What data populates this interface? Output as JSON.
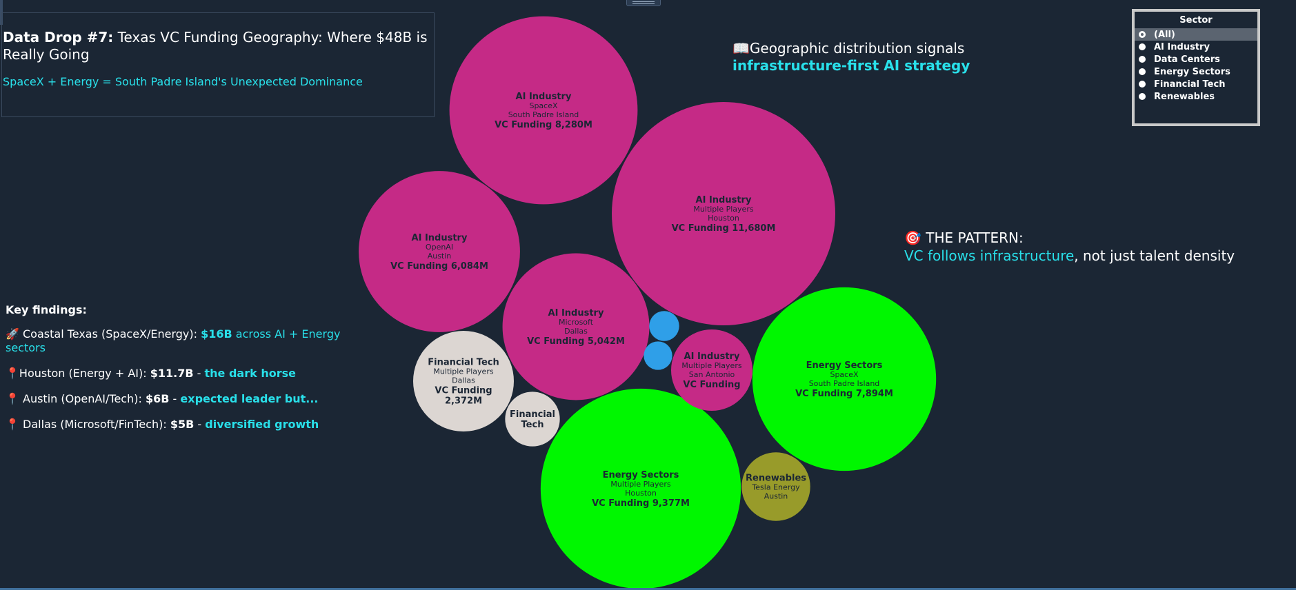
{
  "header": {
    "title_bold": "Data Drop #7:",
    "title_rest": " Texas VC Funding Geography: Where $48B is Really Going",
    "subtitle": "SpaceX + Energy = South Padre Island's Unexpected Dominance"
  },
  "annotations": {
    "top_line1": "Geographic distribution signals",
    "top_line2": "infrastructure-first AI strategy",
    "pattern_head": "THE PATTERN:",
    "pattern_cyan": "VC follows infrastructure",
    "pattern_rest": ", not just talent density"
  },
  "findings": {
    "heading": "Key findings:",
    "items": [
      {
        "prefix": " Coastal Texas (SpaceX/Energy): ",
        "value": "$16B",
        "suffix": " across AI + Energy sectors"
      },
      {
        "prefix": "Houston (Energy + AI): ",
        "value": "$11.7B",
        "sep": " - ",
        "suffix": "the dark horse"
      },
      {
        "prefix": " Austin (OpenAI/Tech): ",
        "value": "$6B",
        "sep": " - ",
        "suffix": "expected leader but..."
      },
      {
        "prefix": " Dallas (Microsoft/FinTech): ",
        "value": "$5B",
        "sep": " - ",
        "suffix": "diversified growth"
      }
    ]
  },
  "legend": {
    "title": "Sector",
    "options": [
      "(All)",
      "AI Industry",
      "Data Centers",
      "Energy Sectors",
      "Financial Tech",
      "Renewables"
    ],
    "selected": "(All)"
  },
  "colors": {
    "AI Industry": "#c52a86",
    "Data Centers": "#2f9fe8",
    "Energy Sectors": "#00f700",
    "Financial Tech": "#dcd6d2",
    "Renewables": "#989b2a"
  },
  "icons": [
    "book-icon",
    "target-icon",
    "rocket-icon",
    "pin-icon"
  ],
  "chart_data": {
    "type": "bubble",
    "value_label": "VC Funding",
    "unit": "M",
    "bubbles": [
      {
        "sector": "AI Industry",
        "company": "Multiple Players",
        "city": "Houston",
        "value": 11680,
        "label": "VC Funding 11,680M"
      },
      {
        "sector": "Energy Sectors",
        "company": "Multiple Players",
        "city": "Houston",
        "value": 9377,
        "label": "VC Funding 9,377M"
      },
      {
        "sector": "AI Industry",
        "company": "SpaceX",
        "city": "South Padre Island",
        "value": 8280,
        "label": "VC Funding 8,280M"
      },
      {
        "sector": "Energy Sectors",
        "company": "SpaceX",
        "city": "South Padre Island",
        "value": 7894,
        "label": "VC Funding 7,894M"
      },
      {
        "sector": "AI Industry",
        "company": "OpenAI",
        "city": "Austin",
        "value": 6084,
        "label": "VC Funding 6,084M"
      },
      {
        "sector": "AI Industry",
        "company": "Microsoft",
        "city": "Dallas",
        "value": 5042,
        "label": "VC Funding 5,042M"
      },
      {
        "sector": "Financial Tech",
        "company": "Multiple Players",
        "city": "Dallas",
        "value": 2372,
        "label": "VC Funding 2,372M"
      },
      {
        "sector": "AI Industry",
        "company": "Multiple Players",
        "city": "San Antonio",
        "value": 1550,
        "label": "VC Funding"
      },
      {
        "sector": "Renewables",
        "company": "Tesla Energy",
        "city": "Austin",
        "value": 1100,
        "label": ""
      },
      {
        "sector": "Financial Tech",
        "company": "",
        "city": "",
        "value": 700,
        "label": ""
      },
      {
        "sector": "Data Centers",
        "company": "",
        "city": "",
        "value": 210,
        "label": ""
      },
      {
        "sector": "Data Centers",
        "company": "",
        "city": "",
        "value": 190,
        "label": ""
      }
    ]
  }
}
